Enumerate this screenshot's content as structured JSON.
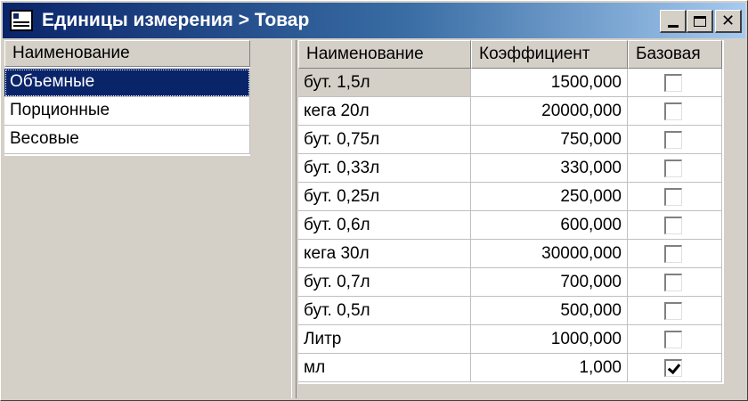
{
  "window": {
    "title": "Единицы измерения > Товар",
    "buttons": {
      "minimize": "_",
      "maximize": "□",
      "close": "✕"
    }
  },
  "categories": {
    "header": "Наименование",
    "items": [
      "Объемные",
      "Порционные",
      "Весовые"
    ],
    "selected_index": 0
  },
  "units_grid": {
    "columns": [
      "Наименование",
      "Коэффициент",
      "Базовая"
    ],
    "selected_row": 0,
    "rows": [
      {
        "name": "бут. 1,5л",
        "coef": "1500,000",
        "base": false
      },
      {
        "name": "кега 20л",
        "coef": "20000,000",
        "base": false
      },
      {
        "name": "бут. 0,75л",
        "coef": "750,000",
        "base": false
      },
      {
        "name": "бут. 0,33л",
        "coef": "330,000",
        "base": false
      },
      {
        "name": "бут. 0,25л",
        "coef": "250,000",
        "base": false
      },
      {
        "name": "бут. 0,6л",
        "coef": "600,000",
        "base": false
      },
      {
        "name": "кега 30л",
        "coef": "30000,000",
        "base": false
      },
      {
        "name": "бут. 0,7л",
        "coef": "700,000",
        "base": false
      },
      {
        "name": "бут. 0,5л",
        "coef": "500,000",
        "base": false
      },
      {
        "name": "Литр",
        "coef": "1000,000",
        "base": false
      },
      {
        "name": "мл",
        "coef": "1,000",
        "base": true
      }
    ]
  },
  "colors": {
    "title_start": "#0a246a",
    "title_end": "#a6caf0",
    "selection": "#0a246a",
    "face": "#d4d0c8"
  }
}
